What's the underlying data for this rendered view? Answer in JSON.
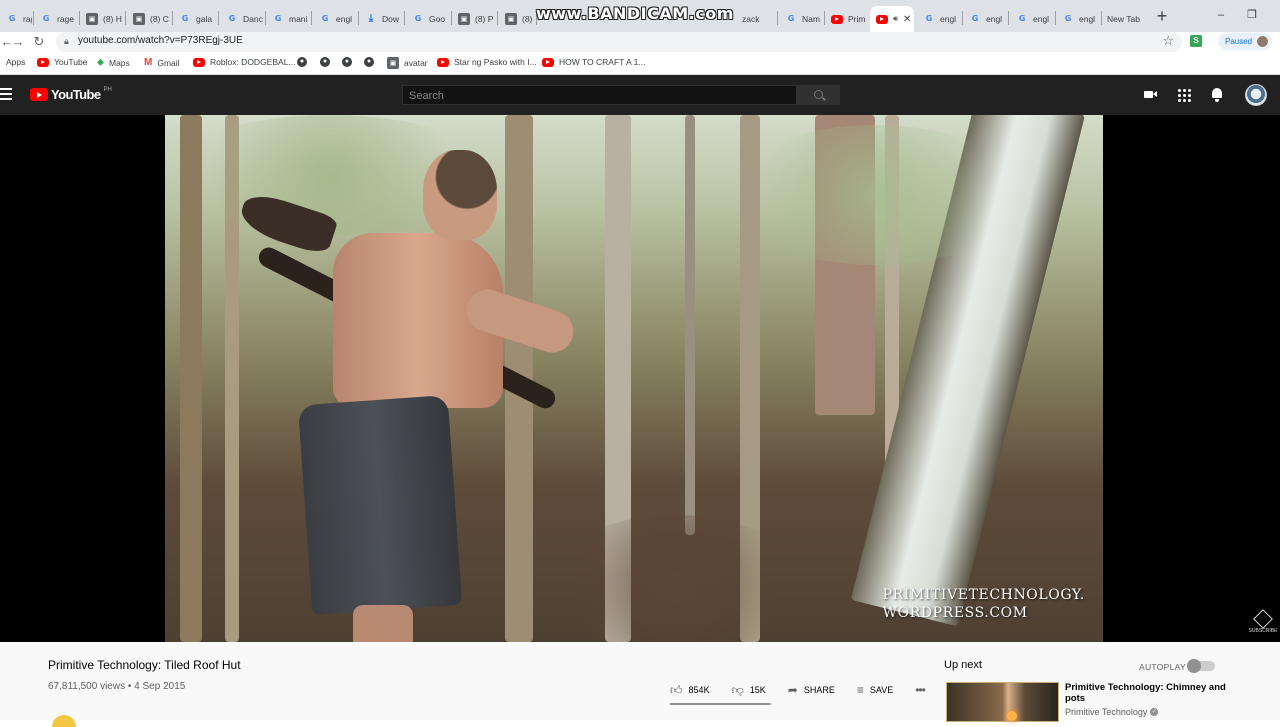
{
  "browser": {
    "tabs": [
      {
        "label": "ragin",
        "favicon": "google"
      },
      {
        "label": "rage",
        "favicon": "google"
      },
      {
        "label": "(8) H",
        "favicon": "box"
      },
      {
        "label": "(8) C",
        "favicon": "box"
      },
      {
        "label": "gala",
        "favicon": "google"
      },
      {
        "label": "Danc",
        "favicon": "google"
      },
      {
        "label": "mani",
        "favicon": "google"
      },
      {
        "label": "engl",
        "favicon": "google"
      },
      {
        "label": "Dow",
        "favicon": "download"
      },
      {
        "label": "Goo",
        "favicon": "google"
      },
      {
        "label": "(8) P",
        "favicon": "box"
      },
      {
        "label": "(8)",
        "favicon": "box"
      },
      {
        "label": "zack",
        "favicon": "none"
      },
      {
        "label": "Nam",
        "favicon": "google"
      },
      {
        "label": "Prim",
        "favicon": "youtube"
      },
      {
        "label": "",
        "favicon": "youtube",
        "active": true
      },
      {
        "label": "engl",
        "favicon": "google"
      },
      {
        "label": "engl",
        "favicon": "google"
      },
      {
        "label": "engl",
        "favicon": "google"
      },
      {
        "label": "engl",
        "favicon": "google"
      },
      {
        "label": "New Tab",
        "favicon": "none"
      }
    ],
    "new_tab_symbol": "+",
    "window_controls": {
      "minimize": "–",
      "restore": "❐"
    },
    "url": "youtube.com/watch?v=P73REgj-3UE",
    "profile_status": "Paused",
    "recording_watermark": "www.BANDICAM.com"
  },
  "bookmarks": [
    {
      "label": "Apps",
      "icon": "apps-grid-icon"
    },
    {
      "label": "YouTube",
      "icon": "youtube-icon"
    },
    {
      "label": "Maps",
      "icon": "maps-icon"
    },
    {
      "label": "Gmail",
      "icon": "gmail-icon"
    },
    {
      "label": "Roblox: DODGEBAL...",
      "icon": "youtube-icon"
    },
    {
      "label": "",
      "icon": "globe-icon"
    },
    {
      "label": "",
      "icon": "globe-icon"
    },
    {
      "label": "",
      "icon": "globe-icon"
    },
    {
      "label": "",
      "icon": "globe-icon"
    },
    {
      "label": "avatar",
      "icon": "box-icon"
    },
    {
      "label": "Star ng Pasko with I...",
      "icon": "youtube-icon"
    },
    {
      "label": "HOW TO CRAFT A 1...",
      "icon": "youtube-icon"
    }
  ],
  "youtube": {
    "logo_text": "YouTube",
    "country_code": "PH",
    "search_placeholder": "Search",
    "video": {
      "title": "Primitive Technology: Tiled Roof Hut",
      "views": "67,811,500 views",
      "date": "4 Sep 2015",
      "watermark_line1": "PRIMITIVETECHNOLOGY.",
      "watermark_line2": "WORDPRESS.COM",
      "likes": "854K",
      "dislikes": "15K",
      "share_label": "SHARE",
      "save_label": "SAVE",
      "subscribe_watermark": "SUBSCRIBE"
    },
    "up_next": {
      "heading": "Up next",
      "autoplay_label": "AUTOPLAY",
      "autoplay_on": false,
      "title": "Primitive Technology: Chimney and pots",
      "channel": "Primitive Technology"
    }
  }
}
